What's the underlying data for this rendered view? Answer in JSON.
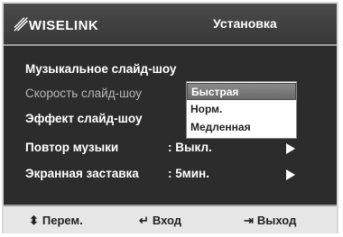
{
  "header": {
    "brand": "WISELINK",
    "title": "Установка"
  },
  "menu": {
    "items": [
      {
        "label": "Музыкальное слайд-шоу",
        "value": ""
      },
      {
        "label": "Скорость слайд-шоу",
        "value": ""
      },
      {
        "label": "Эффект слайд-шоу",
        "value": ""
      },
      {
        "label": "Повтор музыки",
        "value": ":  Выкл."
      },
      {
        "label": "Экранная заставка",
        "value": ":  5мин."
      }
    ]
  },
  "dropdown": {
    "options": [
      "Быстрая",
      "Норм.",
      "Медленная"
    ],
    "selected": "Быстрая"
  },
  "footer": {
    "move": "Перем.",
    "enter": "Вход",
    "exit": "Выход"
  },
  "colors": {
    "background": "#2c2c2c",
    "highlight": "#7a7a7a",
    "footer": "#e6e6e6"
  }
}
